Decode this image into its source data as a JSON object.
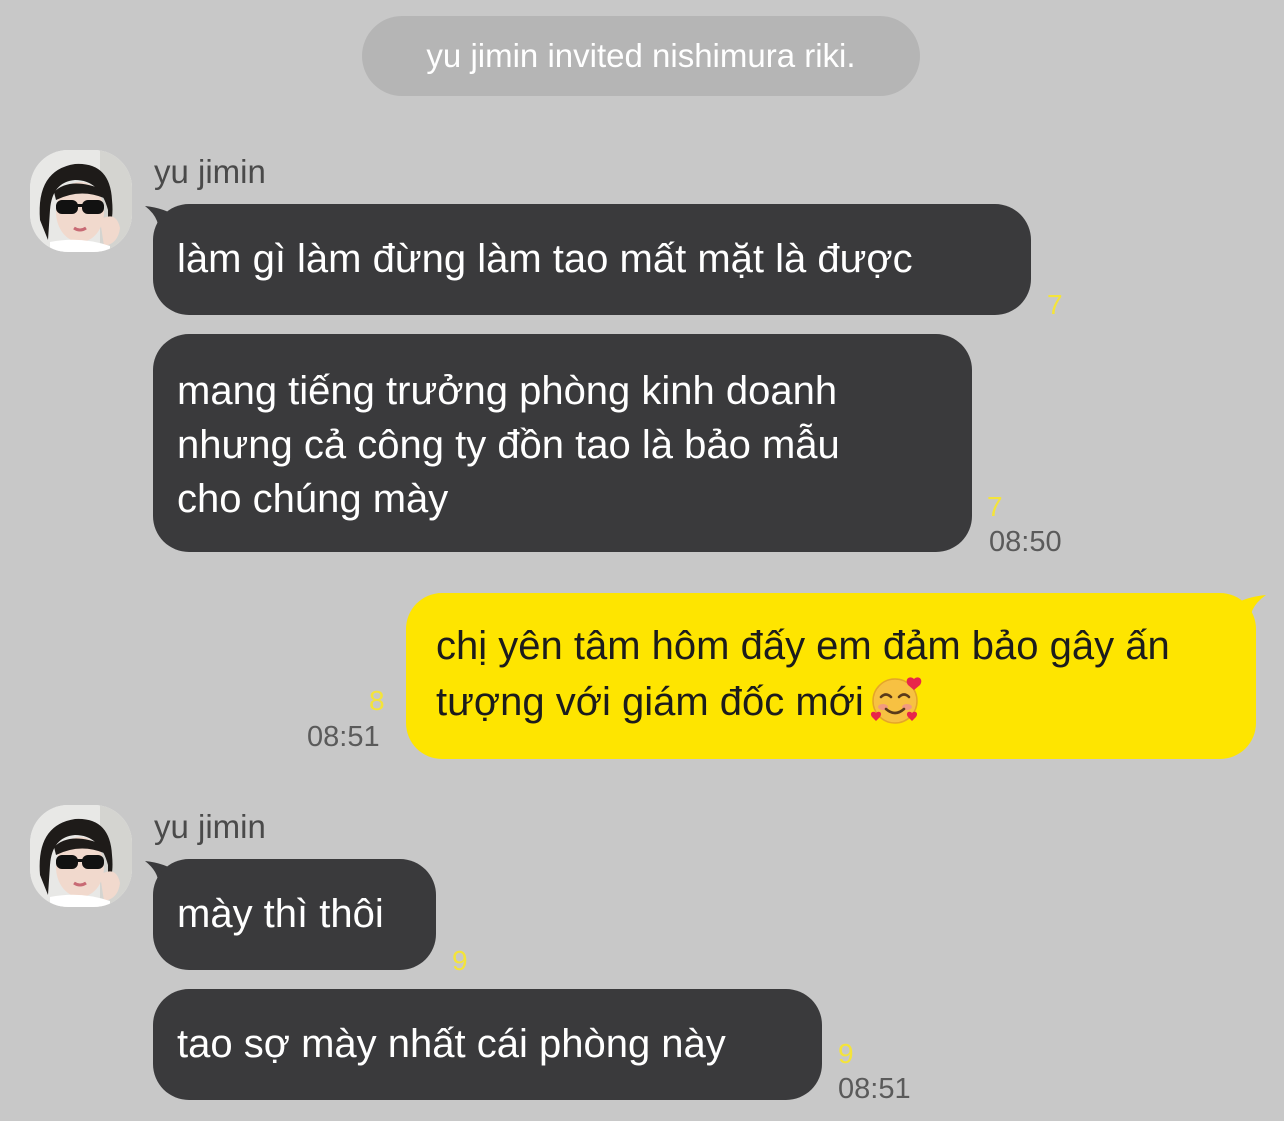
{
  "system_notice": "yu jimin invited nishimura riki.",
  "groups": [
    {
      "sender": "yu jimin",
      "messages": [
        {
          "text": "làm gì làm đừng làm tao mất mặt là được",
          "unread": "7"
        },
        {
          "text": "mang tiếng trưởng phòng kinh doanh\nnhưng cả công ty đồn tao là bảo mẫu\ncho chúng mày",
          "unread": "7",
          "time": "08:50"
        }
      ]
    },
    {
      "sender": "me",
      "messages": [
        {
          "text": "chị yên tâm hôm đấy em đảm bảo gây ấn tượng với giám đốc mới",
          "emoji": "smiling-face-with-hearts",
          "unread": "8",
          "time": "08:51"
        }
      ]
    },
    {
      "sender": "yu jimin",
      "messages": [
        {
          "text": "mày thì thôi",
          "unread": "9"
        },
        {
          "text": "tao sợ mày nhất cái phòng này",
          "unread": "9",
          "time": "08:51"
        }
      ]
    }
  ],
  "icons": {
    "avatar": "profile-photo-girl-sunglasses",
    "emoji": "smiling-face-with-hearts-icon"
  },
  "colors": {
    "background": "#c8c8c8",
    "incoming_bubble": "#3a3a3c",
    "outgoing_bubble": "#fee500",
    "unread_count": "#f4e43a",
    "system_pill": "#b5b5b5"
  }
}
